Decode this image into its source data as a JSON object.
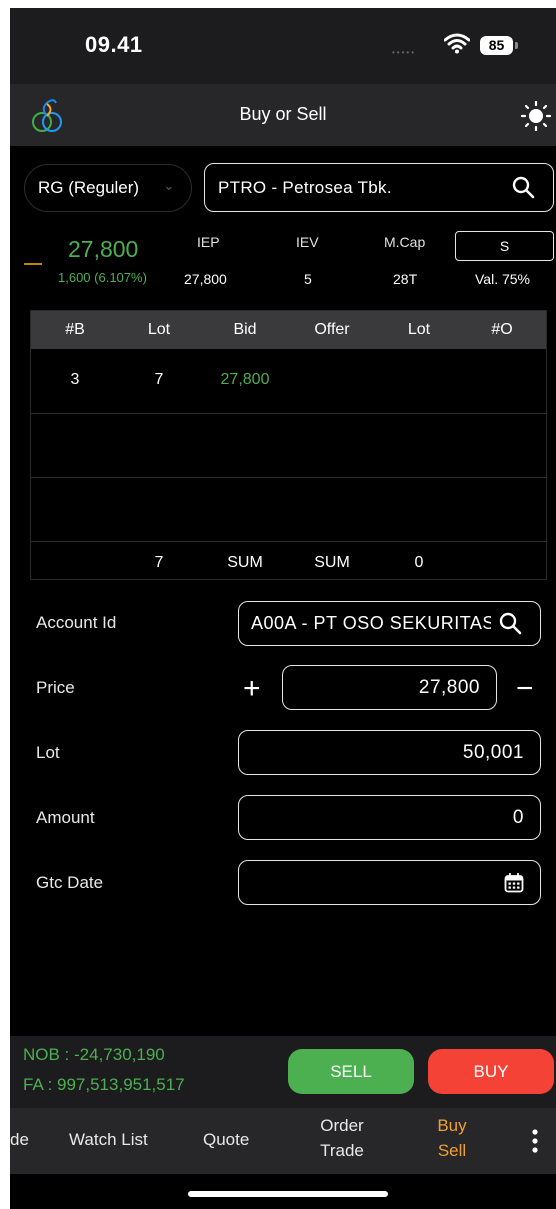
{
  "status": {
    "time": "09.41",
    "battery": "85"
  },
  "header": {
    "title": "Buy or Sell"
  },
  "board": {
    "label": "RG (Reguler)"
  },
  "search": {
    "value": "PTRO - Petrosea Tbk."
  },
  "quote": {
    "last": "27,800",
    "change": "1,600 (6.107%)",
    "iep_label": "IEP",
    "iep": "27,800",
    "iev_label": "IEV",
    "iev": "5",
    "mcap_label": "M.Cap",
    "mcap": "28T",
    "s_button": "S",
    "val": "Val. 75%"
  },
  "orderbook": {
    "headers": [
      "#B",
      "Lot",
      "Bid",
      "Offer",
      "Lot",
      "#O"
    ],
    "rows": [
      {
        "nb": "3",
        "lot_b": "7",
        "bid": "27,800",
        "offer": "",
        "lot_o": "",
        "no": ""
      }
    ],
    "footer": {
      "lot_b_sum": "7",
      "bid_sum": "SUM",
      "offer_sum": "SUM",
      "lot_o_sum": "0"
    }
  },
  "form": {
    "account_label": "Account Id",
    "account_value": "A00A - PT OSO SEKURITAS",
    "price_label": "Price",
    "price_value": "27,800",
    "lot_label": "Lot",
    "lot_value": "50,001",
    "amount_label": "Amount",
    "amount_value": "0",
    "gtc_label": "Gtc Date",
    "gtc_value": ""
  },
  "summary": {
    "nob": "NOB : -24,730,190",
    "fa": "FA : 997,513,951,517"
  },
  "actions": {
    "sell": "SELL",
    "buy": "BUY"
  },
  "tabs": {
    "trade_partial": "de",
    "watchlist": "Watch List",
    "quote": "Quote",
    "order_trade_1": "Order",
    "order_trade_2": "Trade",
    "buy_sell_1": "Buy",
    "buy_sell_2": "Sell"
  },
  "colors": {
    "up": "#4caf50",
    "sell": "#4caf50",
    "buy": "#f44336",
    "active_tab": "#f0a030"
  }
}
